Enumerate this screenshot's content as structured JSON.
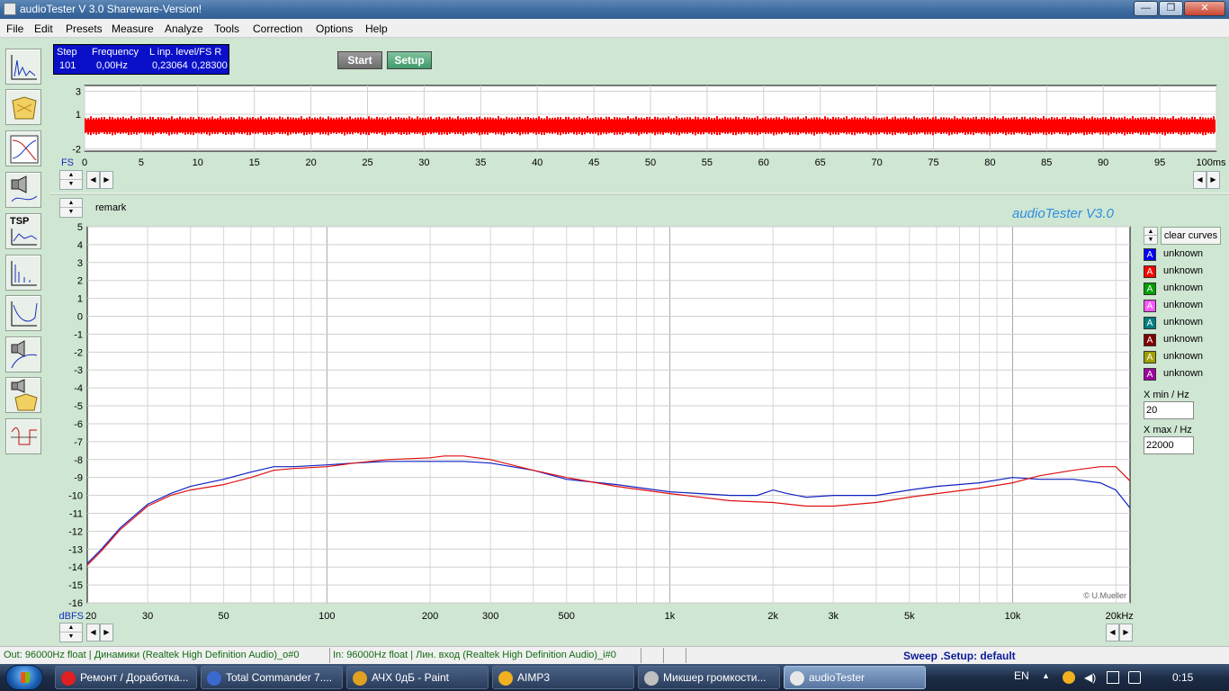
{
  "window": {
    "title": "audioTester  V 3.0 Shareware-Version!"
  },
  "window_controls": {
    "minimize": "—",
    "maximize": "❐",
    "close": "✕"
  },
  "menu": [
    "File",
    "Edit",
    "Presets",
    "Measure",
    "Analyze",
    "Tools",
    "Correction",
    "Options",
    "Help"
  ],
  "info_panel": {
    "step_header": "Step",
    "frequency_header": "Frequency",
    "level_header": "L  inp. level/FS  R",
    "step": "101",
    "frequency": "0,00Hz",
    "level_left": "0,23064",
    "level_right": "0,28300"
  },
  "buttons": {
    "start": "Start",
    "setup": "Setup",
    "clear_curves": "clear curves"
  },
  "remark": "remark",
  "brand": "audioTester  V3.0",
  "scope": {
    "y_ticks": [
      "3",
      "1",
      "-2"
    ],
    "x_ticks": [
      "0",
      "5",
      "10",
      "15",
      "20",
      "25",
      "30",
      "35",
      "40",
      "45",
      "50",
      "55",
      "60",
      "65",
      "70",
      "75",
      "80",
      "85",
      "90",
      "95",
      "100ms"
    ],
    "x_label_prefix": "FS",
    "signal_color": "#ff0000"
  },
  "legend": [
    {
      "label": "unknown",
      "color": "#0000ff"
    },
    {
      "label": "unknown",
      "color": "#ff0000"
    },
    {
      "label": "unknown",
      "color": "#00a000"
    },
    {
      "label": "unknown",
      "color": "#ff55ff"
    },
    {
      "label": "unknown",
      "color": "#008080"
    },
    {
      "label": "unknown",
      "color": "#800000"
    },
    {
      "label": "unknown",
      "color": "#a0a000"
    },
    {
      "label": "unknown",
      "color": "#a000a0"
    }
  ],
  "xrange": {
    "min_label": "X min / Hz",
    "min": "20",
    "max_label": "X max / Hz",
    "max": "22000"
  },
  "chart_data": {
    "type": "line",
    "title": "",
    "xlabel": "",
    "ylabel": "dBFS",
    "xscale": "log",
    "xlim": [
      20,
      22000
    ],
    "ylim": [
      -16,
      5
    ],
    "x_tick_labels": [
      "20",
      "30",
      "50",
      "100",
      "200",
      "300",
      "500",
      "1k",
      "2k",
      "3k",
      "5k",
      "10k",
      "20kHz"
    ],
    "x_tick_values": [
      20,
      30,
      50,
      100,
      200,
      300,
      500,
      1000,
      2000,
      3000,
      5000,
      10000,
      20000
    ],
    "y_ticks": [
      5,
      4,
      3,
      2,
      1,
      0,
      -1,
      -2,
      -3,
      -4,
      -5,
      -6,
      -7,
      -8,
      -9,
      -10,
      -11,
      -12,
      -13,
      -14,
      -15,
      -16
    ],
    "grid": true,
    "watermark": "© U.Mueller",
    "series": [
      {
        "color": "#1020c0",
        "x": [
          20,
          22,
          25,
          30,
          35,
          40,
          50,
          60,
          70,
          80,
          100,
          120,
          150,
          200,
          250,
          300,
          400,
          500,
          700,
          1000,
          1500,
          1800,
          2000,
          2200,
          2500,
          3000,
          4000,
          5000,
          6000,
          8000,
          10000,
          12000,
          15000,
          18000,
          20000,
          22000
        ],
        "y": [
          -13.8,
          -13.0,
          -11.8,
          -10.5,
          -9.9,
          -9.5,
          -9.1,
          -8.7,
          -8.4,
          -8.4,
          -8.3,
          -8.2,
          -8.1,
          -8.1,
          -8.1,
          -8.2,
          -8.6,
          -9.1,
          -9.4,
          -9.8,
          -10.0,
          -10.0,
          -9.7,
          -9.9,
          -10.1,
          -10.0,
          -10.0,
          -9.7,
          -9.5,
          -9.3,
          -9.0,
          -9.1,
          -9.1,
          -9.3,
          -9.7,
          -10.7
        ]
      },
      {
        "color": "#e01010",
        "x": [
          20,
          22,
          25,
          30,
          35,
          40,
          50,
          60,
          70,
          80,
          100,
          120,
          150,
          200,
          220,
          250,
          300,
          400,
          500,
          700,
          1000,
          1500,
          2000,
          2500,
          3000,
          4000,
          5000,
          6000,
          8000,
          10000,
          12000,
          15000,
          18000,
          20000,
          22000
        ],
        "y": [
          -13.9,
          -13.1,
          -11.9,
          -10.6,
          -10.0,
          -9.7,
          -9.4,
          -9.0,
          -8.6,
          -8.5,
          -8.4,
          -8.2,
          -8.0,
          -7.9,
          -7.8,
          -7.8,
          -8.0,
          -8.6,
          -9.0,
          -9.5,
          -9.9,
          -10.3,
          -10.4,
          -10.6,
          -10.6,
          -10.4,
          -10.1,
          -9.9,
          -9.6,
          -9.3,
          -8.9,
          -8.6,
          -8.4,
          -8.4,
          -9.2
        ]
      }
    ]
  },
  "statusbar": {
    "out": "Out: 96000Hz float  | Динамики (Realtek High Definition Audio)_o#0",
    "in": "In: 96000Hz float  | Лин. вход (Realtek High Definition Audio)_i#0",
    "sweep": "Sweep  .Setup:  default"
  },
  "taskbar": {
    "tasks": [
      {
        "label": "Ремонт / Доработка...",
        "color": "#e02020"
      },
      {
        "label": "Total Commander 7....",
        "color": "#3a6ad0"
      },
      {
        "label": "АЧХ 0дБ - Paint",
        "color": "#e0a020"
      },
      {
        "label": "AIMP3",
        "color": "#f0b020"
      },
      {
        "label": "Микшер громкости...",
        "color": "#c0c0c0"
      },
      {
        "label": "audioTester",
        "color": "#e8e8e8"
      }
    ],
    "lang": "EN",
    "clock": "0:15"
  }
}
